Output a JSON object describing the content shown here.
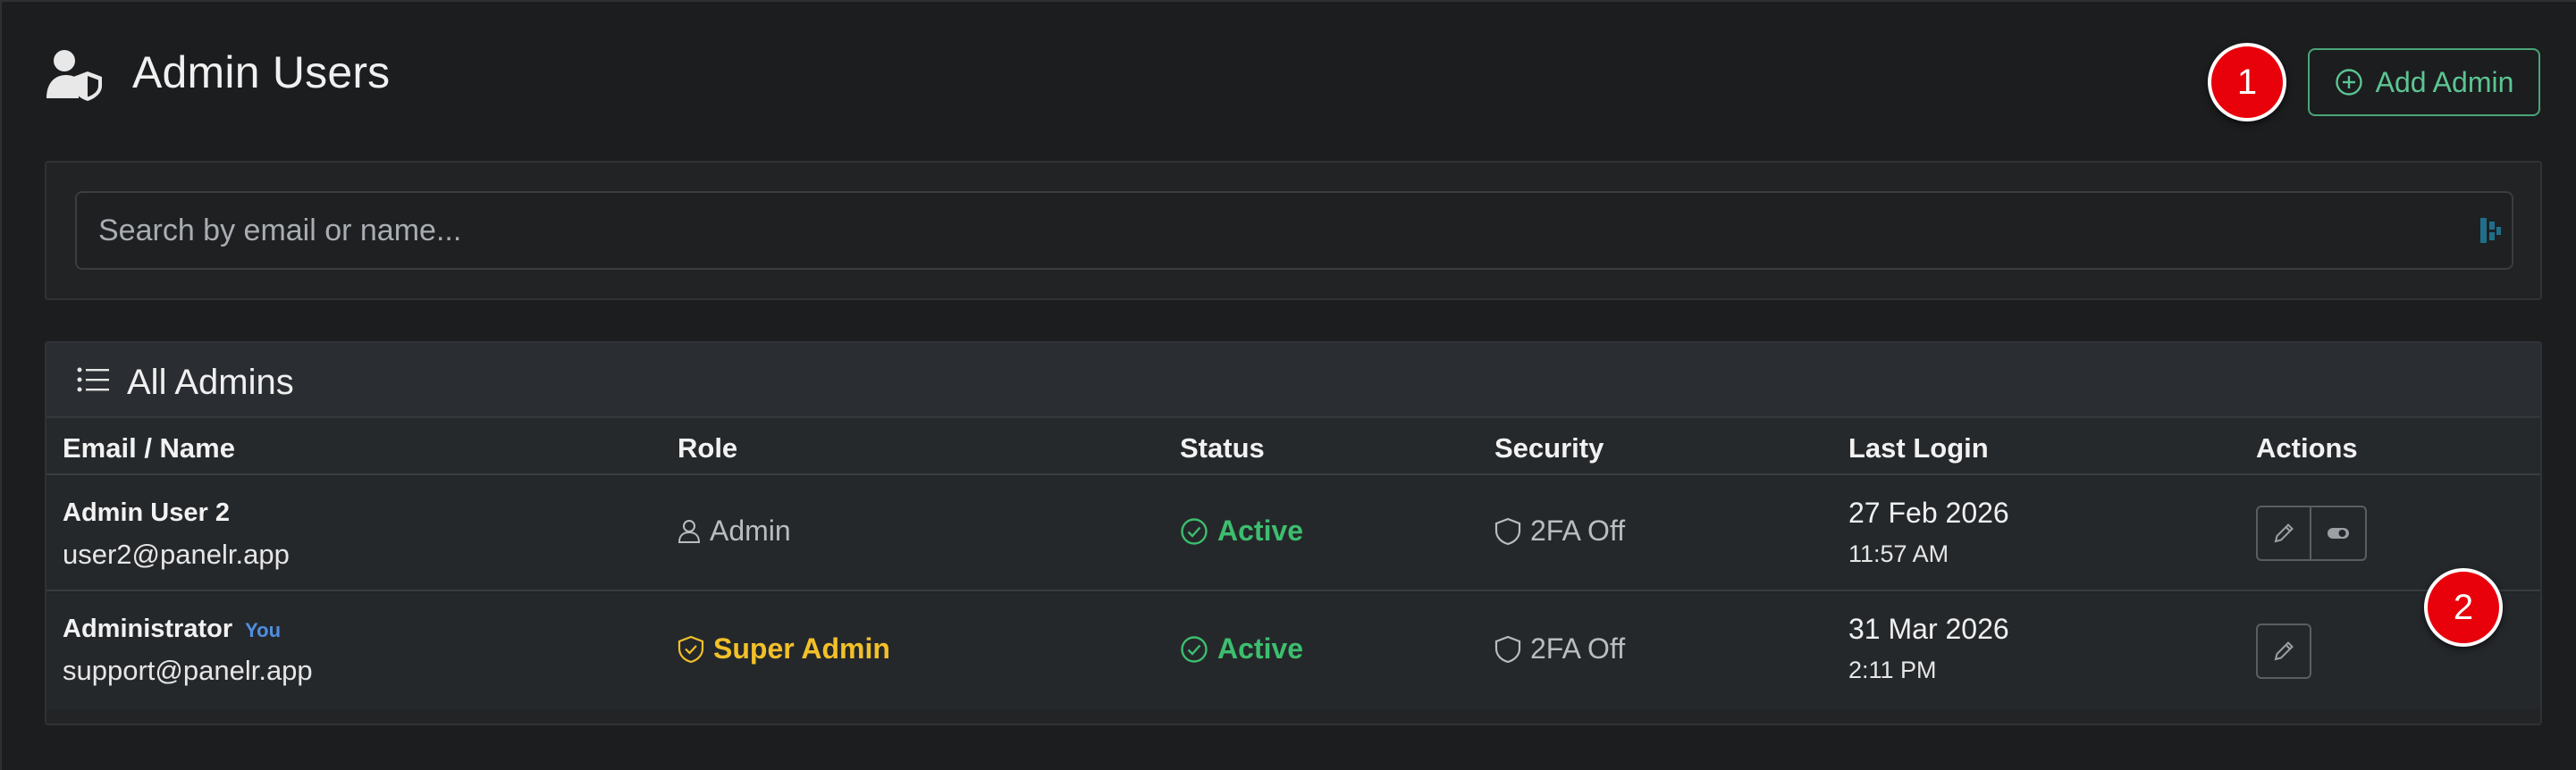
{
  "header": {
    "title": "Admin Users",
    "add_button_label": "Add Admin"
  },
  "annotations": [
    "1",
    "2"
  ],
  "search": {
    "placeholder": "Search by email or name..."
  },
  "table": {
    "title": "All Admins",
    "columns": [
      "Email / Name",
      "Role",
      "Status",
      "Security",
      "Last Login",
      "Actions"
    ],
    "rows": [
      {
        "name": "Admin User 2",
        "you": "",
        "email": "user2@panelr.app",
        "role": "Admin",
        "status": "Active",
        "security": "2FA Off",
        "last_login_date": "27 Feb 2026",
        "last_login_time": "11:57 AM"
      },
      {
        "name": "Administrator",
        "you": "You",
        "email": "support@panelr.app",
        "role": "Super Admin",
        "status": "Active",
        "security": "2FA Off",
        "last_login_date": "31 Mar 2026",
        "last_login_time": "2:11 PM"
      }
    ]
  },
  "colors": {
    "accent_green": "#5cc592",
    "status_active": "#3dbe6f",
    "super_admin": "#f2c029",
    "you_tag": "#4f8fe0",
    "badge_red": "#e8000b"
  },
  "icons": [
    "users-shield-icon",
    "plus-circle-icon",
    "list-icon",
    "person-icon",
    "shield-check-icon",
    "check-circle-icon",
    "shield-icon",
    "pencil-icon",
    "toggle-icon"
  ]
}
